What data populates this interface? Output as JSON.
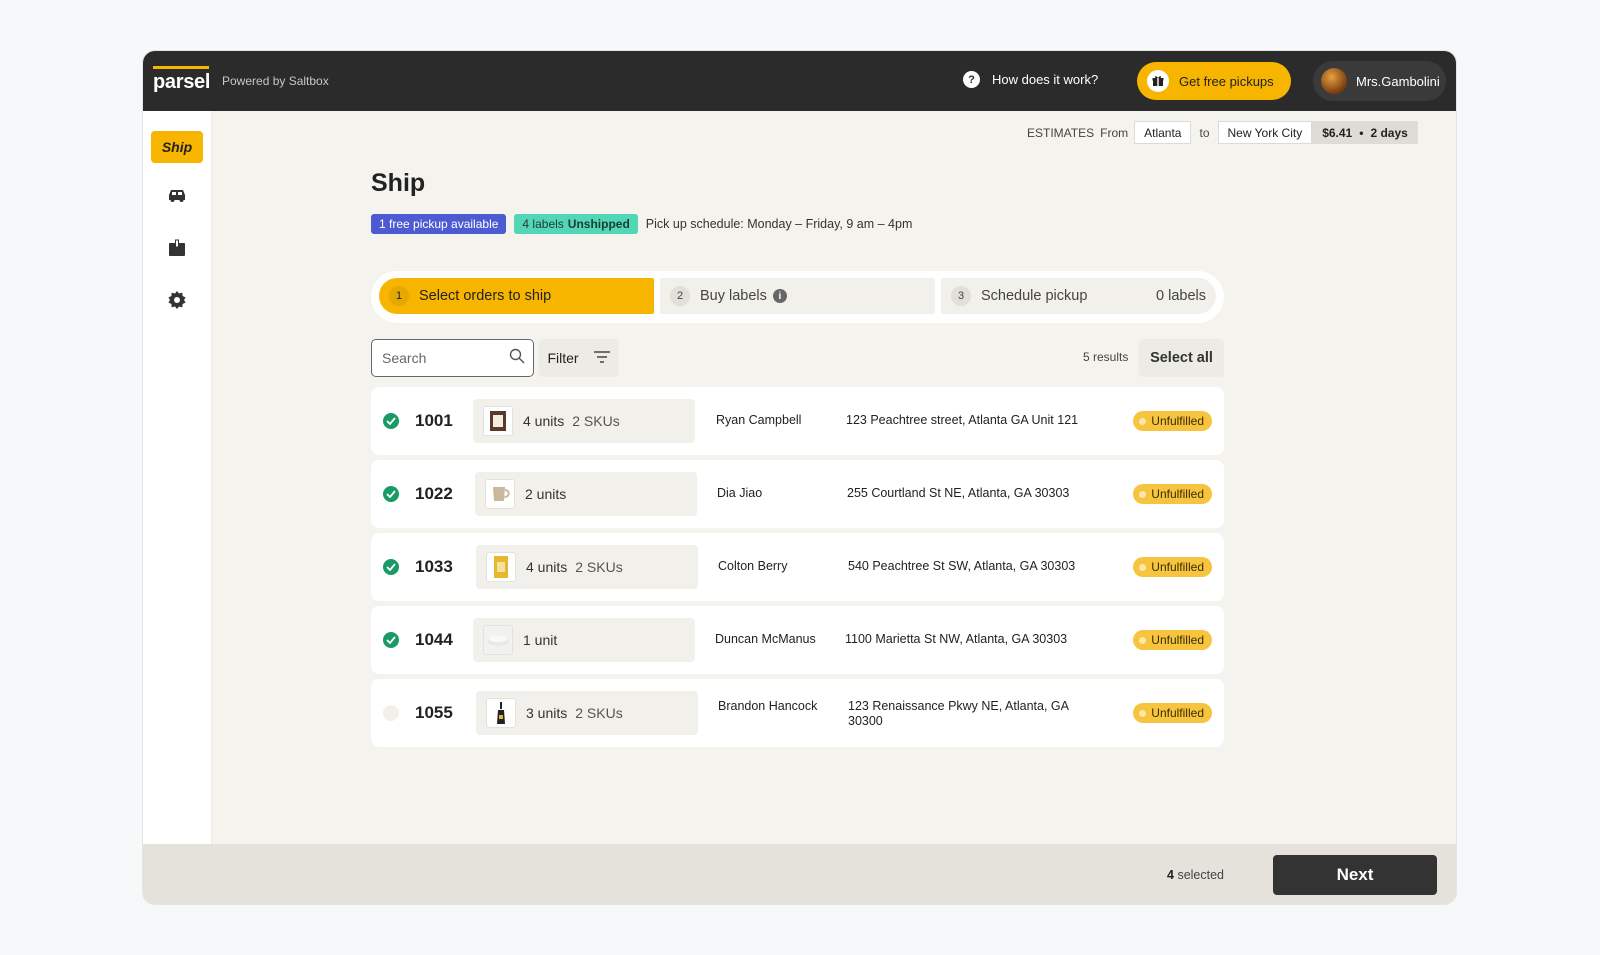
{
  "header": {
    "logo": "parsel",
    "powered_by": "Powered by Saltbox",
    "how_it_works": "How does it work?",
    "free_pickups": "Get free pickups",
    "user_name": "Mrs.Gambolini"
  },
  "sidebar": {
    "ship_label": "Ship",
    "icons": [
      "car-icon",
      "box-icon",
      "gear-icon"
    ]
  },
  "estimates": {
    "label": "ESTIMATES",
    "from_label": "From",
    "from_city": "Atlanta",
    "to_label": "to",
    "to_city": "New York City",
    "price": "$6.41",
    "separator": "•",
    "duration": "2 days"
  },
  "page": {
    "title": "Ship",
    "free_pickup_badge": "1 free pickup available",
    "labels_count": "4 labels",
    "labels_status": "Unshipped",
    "schedule": "Pick up schedule: Monday – Friday, 9 am – 4pm"
  },
  "steps": [
    {
      "num": "1",
      "label": "Select orders to ship"
    },
    {
      "num": "2",
      "label": "Buy labels"
    },
    {
      "num": "3",
      "label": "Schedule pickup",
      "extra": "0 labels"
    }
  ],
  "toolbar": {
    "search_placeholder": "Search",
    "filter_label": "Filter",
    "results": "5 results",
    "select_all": "Select all"
  },
  "orders": [
    {
      "id": "1001",
      "units": "4 units",
      "skus": "2 SKUs",
      "customer": "Ryan Campbell",
      "address": "123 Peachtree street, Atlanta GA Unit 121",
      "status": "Unfulfilled",
      "checked": true
    },
    {
      "id": "1022",
      "units": "2 units",
      "skus": "",
      "customer": "Dia Jiao",
      "address": "255 Courtland St NE, Atlanta, GA 30303",
      "status": "Unfulfilled",
      "checked": true
    },
    {
      "id": "1033",
      "units": "4 units",
      "skus": "2 SKUs",
      "customer": "Colton Berry",
      "address": "540 Peachtree St SW, Atlanta, GA 30303",
      "status": "Unfulfilled",
      "checked": true
    },
    {
      "id": "1044",
      "units": "1 unit",
      "skus": "",
      "customer": "Duncan McManus",
      "address": "1100 Marietta St NW, Atlanta, GA 30303",
      "status": "Unfulfilled",
      "checked": true
    },
    {
      "id": "1055",
      "units": "3 units",
      "skus": "2 SKUs",
      "customer": "Brandon Hancock",
      "address": "123 Renaissance Pkwy NE, Atlanta, GA 30300",
      "status": "Unfulfilled",
      "checked": false
    }
  ],
  "footer": {
    "selected_count": "4",
    "selected_label": "selected",
    "next": "Next"
  },
  "colors": {
    "accent": "#f7b500",
    "dark": "#2b2b2b",
    "check": "#1a9a66",
    "badge_blue": "#4d5bd3",
    "badge_green": "#52d6b6"
  }
}
